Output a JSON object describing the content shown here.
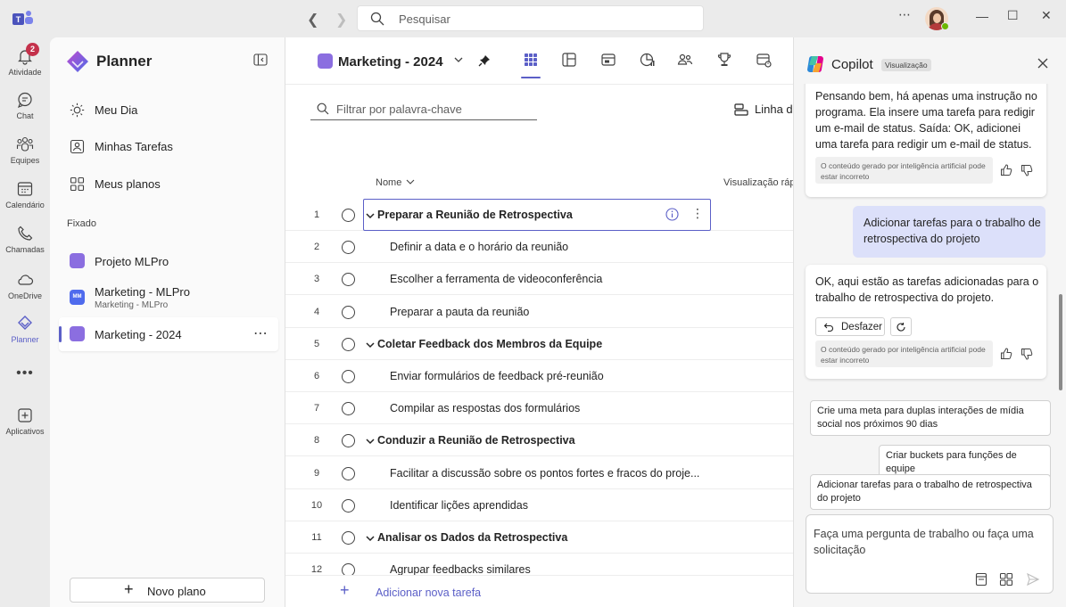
{
  "titlebar": {
    "search_placeholder": "Pesquisar"
  },
  "rail": {
    "items": [
      {
        "label": "Atividade",
        "icon": "bell-icon",
        "badge": "2"
      },
      {
        "label": "Chat",
        "icon": "chat-icon"
      },
      {
        "label": "Equipes",
        "icon": "teams-icon"
      },
      {
        "label": "Calendário",
        "icon": "calendar-icon"
      },
      {
        "label": "Chamadas",
        "icon": "phone-icon"
      },
      {
        "label": "OneDrive",
        "icon": "cloud-icon"
      },
      {
        "label": "Planner",
        "icon": "planner-icon",
        "active": true
      },
      {
        "label": "Aplicativos",
        "icon": "add-apps-icon"
      }
    ]
  },
  "sidebar": {
    "title": "Planner",
    "nav": [
      {
        "label": "Meu Dia",
        "icon": "sun-icon"
      },
      {
        "label": "Minhas Tarefas",
        "icon": "person-tasks-icon"
      },
      {
        "label": "Meus planos",
        "icon": "grid-icon"
      }
    ],
    "pinned_label": "Fixado",
    "plans": [
      {
        "label": "Projeto MLPro"
      },
      {
        "label": "Marketing - MLPro",
        "sublabel": "Marketing - MLPro",
        "icon_text": "MM"
      },
      {
        "label": "Marketing - 2024",
        "selected": true
      }
    ],
    "new_plan_label": "Novo plano"
  },
  "main": {
    "plan_title": "Marketing - 2024",
    "filter_placeholder": "Filtrar por palavra-chave",
    "timeline_label": "Linha do tempo",
    "col_name": "Nome",
    "col_quick": "Visualização rápida",
    "tasks": [
      {
        "num": "1",
        "title": "Preparar a Reunião de Retrospectiva",
        "group": true
      },
      {
        "num": "2",
        "title": "Definir a data e o horário da reunião"
      },
      {
        "num": "3",
        "title": "Escolher a ferramenta de videoconferência"
      },
      {
        "num": "4",
        "title": "Preparar a pauta da reunião"
      },
      {
        "num": "5",
        "title": "Coletar Feedback dos Membros da Equipe",
        "group": true
      },
      {
        "num": "6",
        "title": "Enviar formulários de feedback pré-reunião"
      },
      {
        "num": "7",
        "title": "Compilar as respostas dos formulários"
      },
      {
        "num": "8",
        "title": "Conduzir a Reunião de Retrospectiva",
        "group": true
      },
      {
        "num": "9",
        "title": "Facilitar a discussão sobre os pontos fortes e fracos do proje..."
      },
      {
        "num": "10",
        "title": "Identificar lições aprendidas"
      },
      {
        "num": "11",
        "title": "Analisar os Dados da Retrospectiva",
        "group": true
      },
      {
        "num": "12",
        "title": "Agrupar feedbacks similares"
      }
    ],
    "add_task_label": "Adicionar nova tarefa"
  },
  "copilot": {
    "title": "Copilot",
    "badge": "Visualização",
    "message1": "Pensando bem, há apenas uma instrução no programa. Ela insere uma tarefa para redigir um e-mail de status. Saída: OK, adicionei uma tarefa para redigir um e-mail de status.",
    "disclaimer": "O conteúdo gerado por inteligência artificial pode estar incorreto",
    "user_message": "Adicionar tarefas para o trabalho de retrospectiva do projeto",
    "message2": "OK, aqui estão as tarefas adicionadas para o trabalho de retrospectiva do projeto.",
    "undo_label": "Desfazer",
    "suggestions": [
      "Crie uma meta para duplas interações de mídia social nos próximos 90 dias",
      "Criar buckets para funções de equipe",
      "Adicionar tarefas para o trabalho de retrospectiva do projeto"
    ],
    "composer_placeholder": "Faça uma pergunta de trabalho ou faça uma solicitação"
  },
  "colors": {
    "accent": "#5b5fc7",
    "plan_icon": "#8b6ee0",
    "user_bubble": "#dce0fa",
    "badge_red": "#c4314b"
  }
}
